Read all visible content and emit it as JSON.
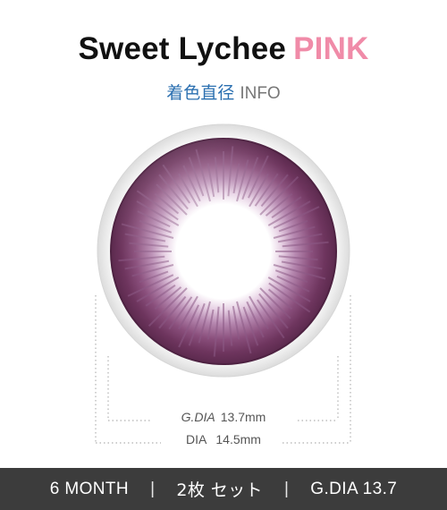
{
  "header": {
    "product_name": "Sweet Lychee",
    "product_color": "PINK",
    "subtitle_jp": "着色直径",
    "subtitle_en": "INFO"
  },
  "specs": {
    "gdia_label": "G.DIA",
    "gdia_value": "13.7mm",
    "dia_label": "DIA",
    "dia_value": "14.5mm"
  },
  "bottom_bar": {
    "period": "6 MONTH",
    "separator": "|",
    "set": "2枚 セット",
    "gdia": "G.DIA 13.7"
  },
  "colors": {
    "accent_pink": "#f08ba8",
    "subtitle_blue": "#2a6fb0",
    "lens_purple": "#7b3f68",
    "bar_background": "#3c3c3c"
  }
}
